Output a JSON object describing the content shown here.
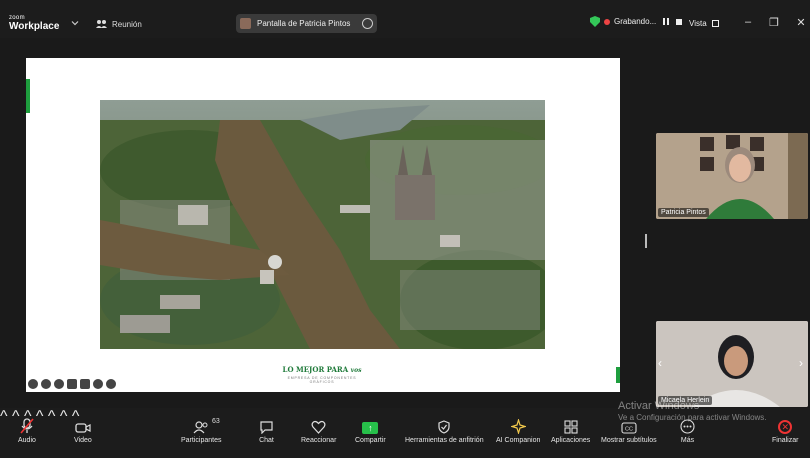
{
  "app": {
    "brand_small": "zoom",
    "brand_big": "Workplace"
  },
  "header": {
    "meeting_label": "Reunión",
    "share_pill_label": "Pantalla de Patricia Pintos",
    "recording_label": "Grabando...",
    "view_label": "Vista"
  },
  "slide": {
    "logo_text": "LO MEJOR PARA",
    "logo_script": "vos",
    "logo_sub": "EMPRESA DE COMPONENTES GRÁFICOS"
  },
  "participants": [
    {
      "name": "Patricia Pintos"
    },
    {
      "name": "Micaela Herlein"
    }
  ],
  "toolbar": {
    "audio": "Audio",
    "video": "Video",
    "participants": "Participantes",
    "participants_count": "63",
    "chat": "Chat",
    "react": "Reaccionar",
    "share": "Compartir",
    "host_tools": "Herramientas de anfitrión",
    "ai_companion": "AI Companion",
    "apps": "Aplicaciones",
    "captions": "Mostrar subtítulos",
    "more": "Más",
    "end": "Finalizar"
  },
  "watermark": {
    "line1": "Activar Windows",
    "line2": "Ve a Configuración para activar Windows."
  },
  "colors": {
    "accent_green": "#27c04a",
    "end_red": "#e33333",
    "logo_green": "#1f7a3a"
  }
}
